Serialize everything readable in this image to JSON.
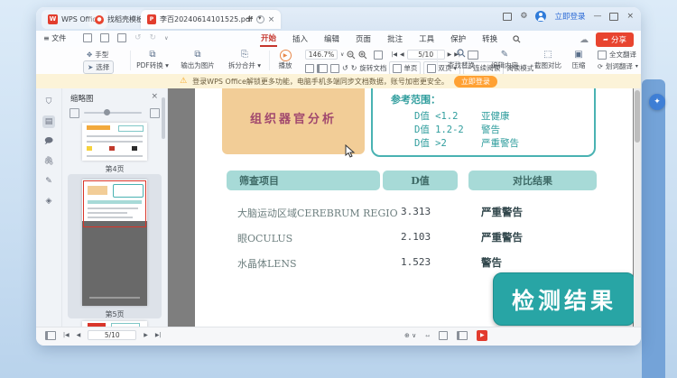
{
  "window": {
    "home_tab": "WPS Office",
    "tabs": [
      {
        "label": "找稻壳模板"
      },
      {
        "label": "李百20240614101525.pdf"
      }
    ],
    "login": "立即登录",
    "share": "分享"
  },
  "menubar": {
    "file": "文件",
    "tabs": [
      "开始",
      "插入",
      "编辑",
      "页面",
      "批注",
      "工具",
      "保护",
      "转换"
    ]
  },
  "toolbar": {
    "hand": "手型",
    "select": "选择",
    "pdf_convert": "PDF转换",
    "export_image": "输出为图片",
    "split_merge": "拆分合并",
    "play": "播放",
    "zoom_value": "146.7%",
    "page_value": "5/10",
    "rotate_doc": "旋转文档",
    "single_page": "单页",
    "two_page": "双页",
    "continuous": "连续阅读",
    "read_mode": "阅读模式",
    "find_replace": "查找替换",
    "edit_content": "编辑内容",
    "capture_compare": "截图对比",
    "compress": "压缩",
    "translate_full": "全文翻译",
    "translate_word": "划词翻译"
  },
  "notice": {
    "text": "登录WPS Office解锁更多功能，电脑手机多端同步文档数据，账号加密更安全。",
    "button": "立即登录"
  },
  "sidebar": {
    "title": "缩略图",
    "pages": [
      {
        "label": "第4页"
      },
      {
        "label": "第5页"
      }
    ]
  },
  "document": {
    "section_title": "组织器官分析",
    "reference": {
      "title": "参考范围：",
      "items": [
        {
          "range": "D值 <1.2",
          "result": "亚健康"
        },
        {
          "range": "D值 1.2-2",
          "result": "警告"
        },
        {
          "range": "D值 >2",
          "result": "严重警告"
        }
      ]
    },
    "table": {
      "headers": [
        "筛查项目",
        "D值",
        "对比结果"
      ],
      "rows": [
        {
          "item": "大脑运动区域CEREBRUM  REGIO",
          "d_value": "3.313",
          "result": "严重警告"
        },
        {
          "item": "眼OCULUS",
          "d_value": "2.103",
          "result": "严重警告"
        },
        {
          "item": "水晶体LENS",
          "d_value": "1.523",
          "result": "警告"
        }
      ]
    },
    "overlay": "检测结果"
  },
  "statusbar": {
    "page_value": "5/10"
  },
  "colors": {
    "wps_red": "#e23d2d",
    "accent_teal": "#28a5a5",
    "header_pill": "#a7dad7",
    "orange_box": "#f2cd97",
    "notice_bg": "#fcf3d8",
    "notice_button": "#ffa133",
    "doc_canvas": "#7e7e7e",
    "desktop_blue": "#cbdff2",
    "strip_blue": "#74a3d8"
  }
}
